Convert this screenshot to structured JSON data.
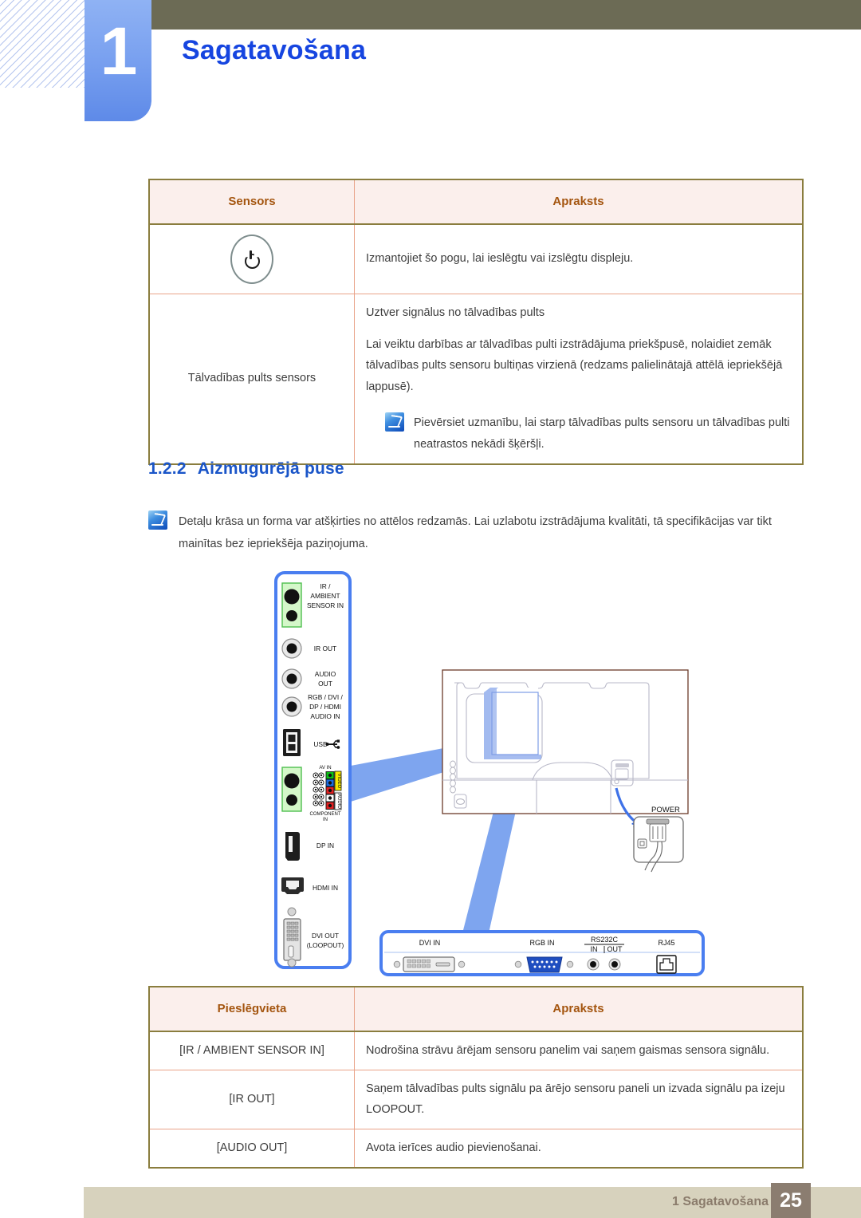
{
  "header": {
    "chapter_number": "1",
    "chapter_title": "Sagatavošana",
    "accent_blue": "#1645e0",
    "olive": "#6c6b55"
  },
  "sensors_table": {
    "headers": [
      "Sensors",
      "Apraksts"
    ],
    "rows": [
      {
        "icon": "power-button-icon",
        "label": "",
        "paragraphs": [
          "Izmantojiet šo pogu, lai ieslēgtu vai izslēgtu displeju."
        ],
        "note": null
      },
      {
        "icon": null,
        "label": "Tālvadības pults sensors",
        "paragraphs": [
          "Uztver signālus no tālvadības pults",
          "Lai veiktu darbības ar tālvadības pulti izstrādājuma priekšpusē, nolaidiet zemāk tālvadības pults sensoru bultiņas virzienā (redzams palielinātajā attēlā iepriekšējā lappusē)."
        ],
        "note": "Pievērsiet uzmanību, lai starp tālvadības pults sensoru un tālvadības pulti neatrastos nekādi šķēršļi."
      }
    ]
  },
  "section": {
    "index": "1.2.2",
    "title": "Aizmugurējā puse"
  },
  "page_note": "Detaļu krāsa un forma var atšķirties no attēlos redzamās. Lai uzlabotu izstrādājuma kvalitāti, tā specifikācijas var tikt mainītas bez iepriekšēja paziņojuma.",
  "diagram": {
    "side_panel_ports": [
      "IR / AMBIENT SENSOR IN",
      "IR OUT",
      "AUDIO OUT",
      "RGB / DVI / DP / HDMI AUDIO IN",
      "USB",
      "AV IN",
      "COMPONENT IN",
      "VIDEO",
      "AUDIO",
      "DP IN",
      "HDMI IN",
      "DVI OUT (LOOPOUT)"
    ],
    "side_panel_labels": {
      "ir_ambient": [
        "IR /",
        "AMBIENT",
        "SENSOR IN"
      ],
      "ir_out": "IR OUT",
      "audio_out": [
        "AUDIO",
        "OUT"
      ],
      "rgb_audio_in": [
        "RGB / DVI /",
        "DP / HDMI",
        "AUDIO IN"
      ],
      "usb": "USB",
      "av_in": "AV IN",
      "video": "VIDEO",
      "audio": "AUDIO",
      "component_in": [
        "COMPONENT",
        "IN"
      ],
      "dp_in": "DP IN",
      "hdmi_in": "HDMI IN",
      "dvi_out": [
        "DVI OUT",
        "(LOOPOUT)"
      ]
    },
    "power_callout": "POWER",
    "bottom_panel_labels": {
      "dvi_in": "DVI IN",
      "rgb_in": "RGB IN",
      "rs232c": "RS232C",
      "rs232c_in": "IN",
      "rs232c_out": "OUT",
      "rj45": "RJ45"
    },
    "colors": {
      "panel_border": "#4a7ef0",
      "arrow": "#7ca2ef",
      "green_highlight": "#64e070",
      "vga_blue": "#1f4ec0",
      "video_yellow": "#f7e800"
    }
  },
  "ports_table": {
    "headers": [
      "Pieslēgvieta",
      "Apraksts"
    ],
    "rows": [
      {
        "port": "[IR / AMBIENT SENSOR IN]",
        "description": "Nodrošina strāvu ārējam sensoru panelim vai saņem gaismas sensora signālu."
      },
      {
        "port": "[IR OUT]",
        "description": "Saņem tālvadības pults signālu pa ārējo sensoru paneli un izvada signālu pa izeju LOOPOUT."
      },
      {
        "port": "[AUDIO OUT]",
        "description": "Avota ierīces audio pievienošanai."
      }
    ]
  },
  "footer": {
    "label": "1 Sagatavošana",
    "page_number": "25"
  }
}
